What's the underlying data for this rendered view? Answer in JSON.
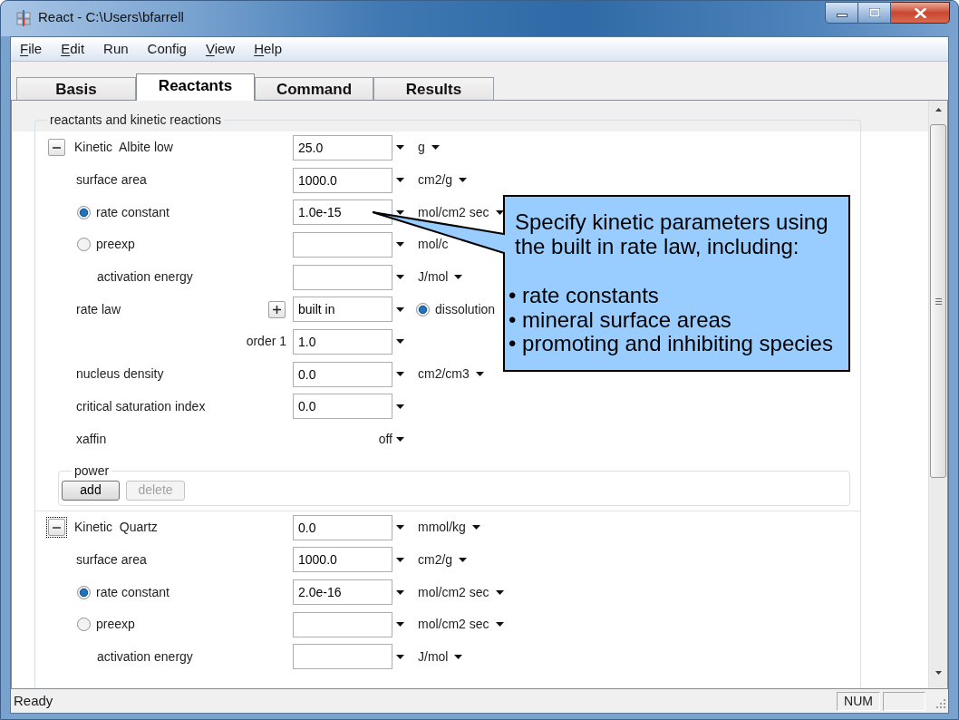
{
  "window": {
    "title": "React - C:\\Users\\bfarrell"
  },
  "menu": [
    {
      "label": "File",
      "mnemonic": true
    },
    {
      "label": "Edit",
      "mnemonic": true
    },
    {
      "label": "Run",
      "mnemonic": false
    },
    {
      "label": "Config",
      "mnemonic": false
    },
    {
      "label": "View",
      "mnemonic": true
    },
    {
      "label": "Help",
      "mnemonic": true
    }
  ],
  "tabs": [
    {
      "label": "Basis",
      "selected": false
    },
    {
      "label": "Reactants",
      "selected": true
    },
    {
      "label": "Command",
      "selected": false
    },
    {
      "label": "Results",
      "selected": false
    }
  ],
  "group": {
    "title": "reactants and kinetic reactions",
    "reactants": [
      {
        "title": "Kinetic  Albite low",
        "expanded": true,
        "focused": false,
        "amount": "25.0",
        "unit": "g",
        "rows": [
          {
            "kind": "field",
            "label": "surface area",
            "value": "1000.0",
            "unit": "cm2/g"
          },
          {
            "kind": "radio",
            "label": "rate constant",
            "selected": true,
            "value": "1.0e-15",
            "unit": "mol/cm2 sec"
          },
          {
            "kind": "radio",
            "label": "preexp",
            "selected": false,
            "unit": "mol/c",
            "unit_caret": false
          },
          {
            "kind": "indented",
            "label": "activation energy",
            "unit": "J/mol"
          },
          {
            "kind": "combo",
            "label": "rate law",
            "value": "built in",
            "option": {
              "label": "dissolution",
              "selected": true
            }
          },
          {
            "kind": "order",
            "label": "order 1",
            "value": "1.0"
          },
          {
            "kind": "field",
            "label": "nucleus density",
            "value": "0.0",
            "unit": "cm2/cm3"
          },
          {
            "kind": "field",
            "label": "critical saturation index",
            "value": "0.0"
          },
          {
            "kind": "switch",
            "label": "xaffin",
            "value": "off"
          }
        ],
        "power": {
          "title": "power",
          "buttons": [
            {
              "label": "add",
              "disabled": false
            },
            {
              "label": "delete",
              "disabled": true
            }
          ]
        }
      },
      {
        "title": "Kinetic  Quartz",
        "expanded": true,
        "focused": true,
        "amount": "0.0",
        "unit": "mmol/kg",
        "rows": [
          {
            "kind": "field",
            "label": "surface area",
            "value": "1000.0",
            "unit": "cm2/g"
          },
          {
            "kind": "radio",
            "label": "rate constant",
            "selected": true,
            "value": "2.0e-16",
            "unit": "mol/cm2 sec"
          },
          {
            "kind": "radio",
            "label": "preexp",
            "selected": false,
            "unit": "mol/cm2 sec"
          },
          {
            "kind": "indented",
            "label": "activation energy",
            "unit": "J/mol"
          }
        ]
      }
    ]
  },
  "callout": {
    "text": "Specify kinetic parameters using the built in rate law, including:",
    "bullets": [
      "• rate constants",
      "• mineral surface areas",
      "• promoting and inhibiting species"
    ]
  },
  "status_bar": {
    "message": "Ready",
    "panels": [
      "NUM"
    ]
  }
}
